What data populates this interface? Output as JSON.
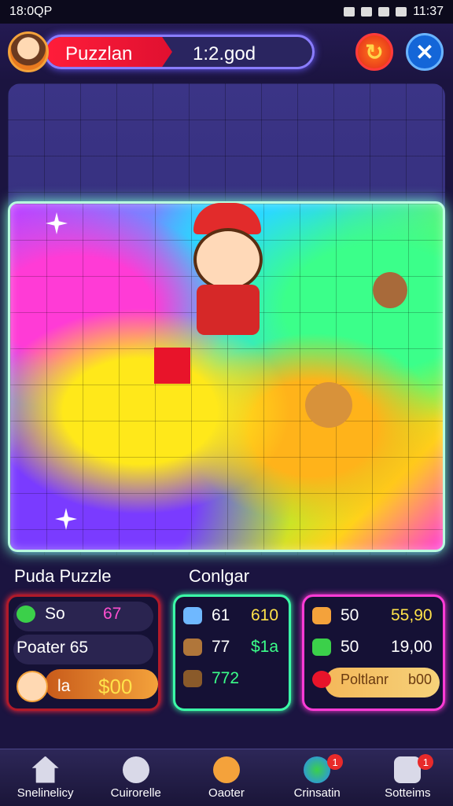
{
  "status_bar": {
    "left_text": "18:0QP",
    "time": "11:37"
  },
  "header": {
    "player_name": "Puzzlan",
    "score": "1:2.god"
  },
  "board": {
    "title": "Puda Puzzle",
    "panel_title": "Conlgar"
  },
  "stats_left": {
    "row1_label": "So",
    "row1_value": "67",
    "row2_text": "Poater 65",
    "row3_label": "la",
    "row3_value": "$00"
  },
  "stats_mid": {
    "row1_a": "61",
    "row1_b": "610",
    "row2_a": "77",
    "row2_b": "$1a",
    "row3_a": "772"
  },
  "stats_right": {
    "row1_a": "50",
    "row1_b": "55,90",
    "row2_a": "50",
    "row2_b": "19,00",
    "row3_text": "Poltlanr",
    "row3_value": "b00"
  },
  "nav": [
    {
      "label": "Snelinelicy",
      "icon": "home-icon",
      "badge": ""
    },
    {
      "label": "Cuirorelle",
      "icon": "gear-icon",
      "badge": ""
    },
    {
      "label": "Oaoter",
      "icon": "compass-icon",
      "badge": ""
    },
    {
      "label": "Crinsatin",
      "icon": "globe-icon",
      "badge": "1"
    },
    {
      "label": "Sotteims",
      "icon": "camera-icon",
      "badge": "1"
    }
  ]
}
